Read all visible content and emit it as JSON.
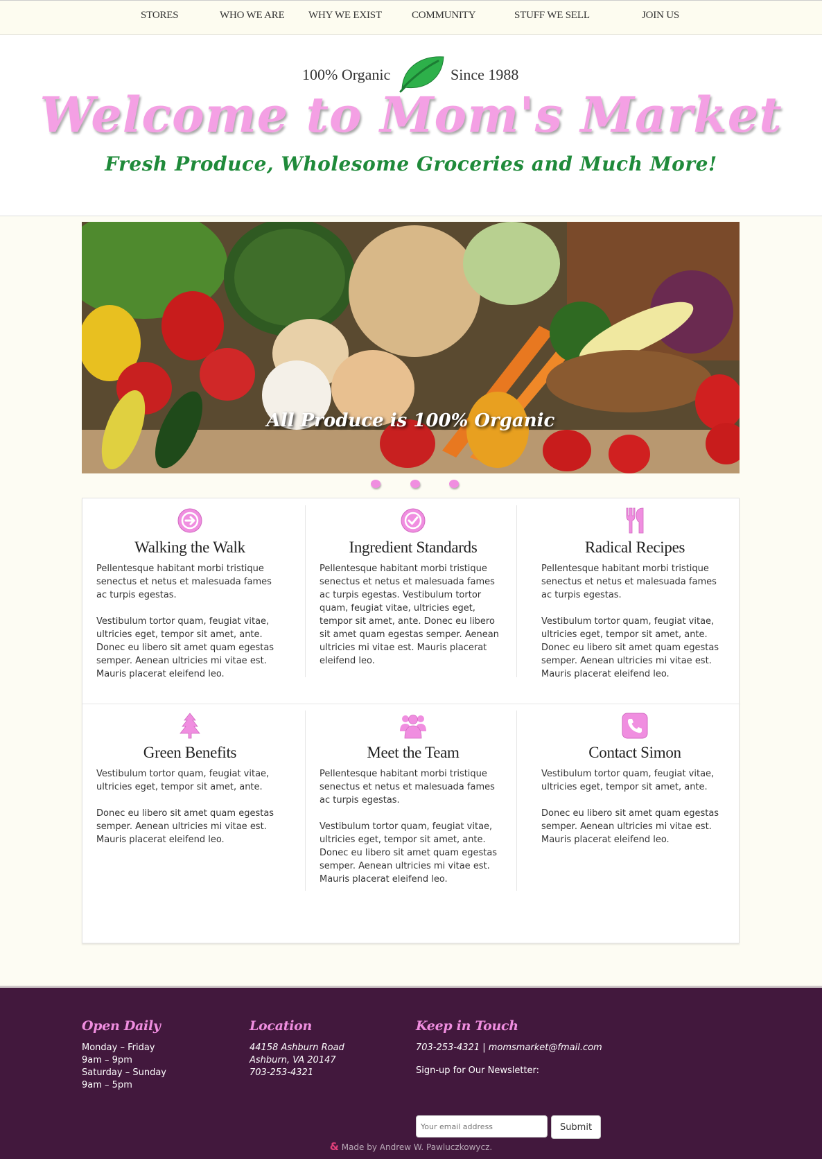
{
  "nav": {
    "items": [
      "STORES",
      "WHO WE ARE",
      "WHY WE EXIST",
      "COMMUNITY",
      "STUFF WE SELL",
      "JOIN US"
    ]
  },
  "header": {
    "left_tag": "100% Organic",
    "right_tag": "Since 1988",
    "logo_icon": "leaf-icon",
    "title": "Welcome to Mom's Market",
    "subtitle": "Fresh Produce, Wholesome Groceries and Much More!"
  },
  "hero": {
    "caption": "All Produce is 100% Organic",
    "slide_count": 3
  },
  "features": [
    {
      "icon": "arrow-right-circle-icon",
      "title": "Walking the Walk",
      "paragraphs": [
        "Pellentesque habitant morbi tristique senectus et netus et malesuada fames ac turpis egestas.",
        "Vestibulum tortor quam, feugiat vitae, ultricies eget, tempor sit amet, ante. Donec eu libero sit amet quam egestas semper. Aenean ultricies mi vitae est. Mauris placerat eleifend leo."
      ]
    },
    {
      "icon": "checkmark-circle-icon",
      "title": "Ingredient Standards",
      "paragraphs": [
        "Pellentesque habitant morbi tristique senectus et netus et malesuada fames ac turpis egestas. Vestibulum tortor quam, feugiat vitae, ultricies eget, tempor sit amet, ante. Donec eu libero sit amet quam egestas semper. Aenean ultricies mi vitae est. Mauris placerat eleifend leo."
      ]
    },
    {
      "icon": "fork-knife-icon",
      "title": "Radical Recipes",
      "paragraphs": [
        "Pellentesque habitant morbi tristique senectus et netus et malesuada fames ac turpis egestas.",
        "Vestibulum tortor quam, feugiat vitae, ultricies eget, tempor sit amet, ante. Donec eu libero sit amet quam egestas semper. Aenean ultricies mi vitae est. Mauris placerat eleifend leo."
      ]
    },
    {
      "icon": "tree-icon",
      "title": "Green Benefits",
      "paragraphs": [
        "Vestibulum tortor quam, feugiat vitae, ultricies eget, tempor sit amet, ante.",
        "Donec eu libero sit amet quam egestas semper. Aenean ultricies mi vitae est. Mauris placerat eleifend leo."
      ]
    },
    {
      "icon": "team-icon",
      "title": "Meet the Team",
      "paragraphs": [
        "Pellentesque habitant morbi tristique senectus et netus et malesuada fames ac turpis egestas.",
        "Vestibulum tortor quam, feugiat vitae, ultricies eget, tempor sit amet, ante. Donec eu libero sit amet quam egestas semper. Aenean ultricies mi vitae est. Mauris placerat eleifend leo."
      ]
    },
    {
      "icon": "phone-icon",
      "title": "Contact Simon",
      "paragraphs": [
        "Vestibulum tortor quam, feugiat vitae, ultricies eget, tempor sit amet, ante.",
        "Donec eu libero sit amet quam egestas semper. Aenean ultricies mi vitae est. Mauris placerat eleifend leo."
      ]
    }
  ],
  "footer": {
    "hours": {
      "heading": "Open Daily",
      "lines": [
        "Monday – Friday",
        "9am – 9pm",
        "Saturday – Sunday",
        "9am – 5pm"
      ]
    },
    "location": {
      "heading": "Location",
      "lines": [
        "44158 Ashburn Road",
        "Ashburn, VA 20147",
        "703-253-4321"
      ]
    },
    "contact": {
      "heading": "Keep in Touch",
      "line": "703-253-4321 | momsmarket@fmail.com",
      "newsletter_label": "Sign-up for Our Newsletter:",
      "email_placeholder": "Your email address",
      "submit_label": "Submit"
    },
    "credit_amp": "&",
    "credit": "Made by Andrew W. Pawluczkowycz."
  },
  "colors": {
    "accent_pink": "#f4a0e4",
    "brand_green": "#1f8a3a",
    "footer_bg": "#42183d",
    "page_bg": "#fdfcf3"
  }
}
